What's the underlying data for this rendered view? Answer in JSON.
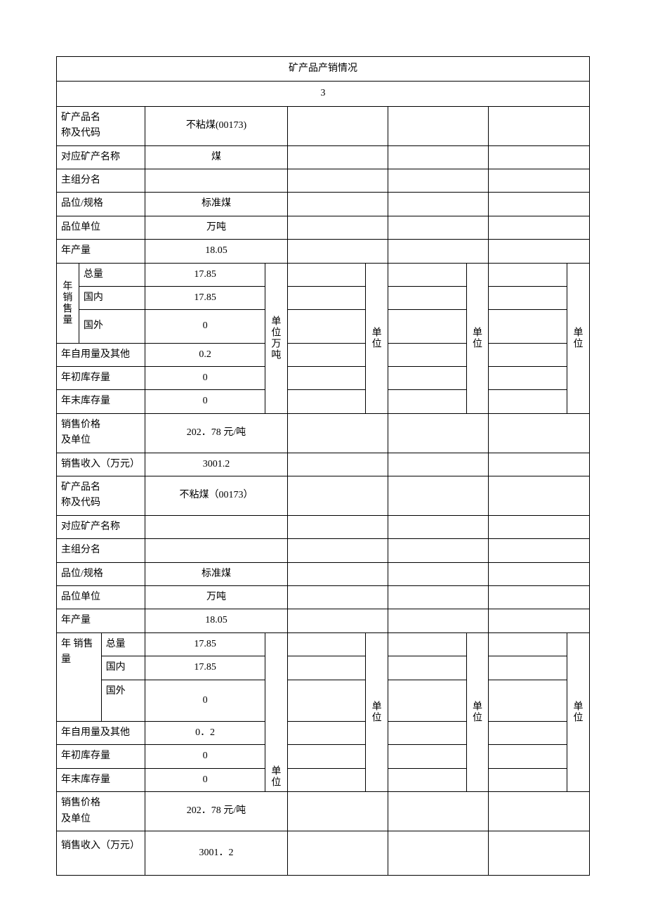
{
  "title": "矿产品产销情况",
  "page_number": "3",
  "labels": {
    "product_name_code": "矿产品名",
    "product_name_code2": "称及代码",
    "corresponding_mineral": "对应矿产名称",
    "main_group": "主组分名",
    "grade_spec": "品位/规格",
    "grade_unit": "品位单位",
    "annual_output": "年产量",
    "annual_sales": "年销售量",
    "annual_sales_v": "年 销售量",
    "total": "总量",
    "domestic": "国内",
    "overseas": "国外",
    "self_use": "年自用量及其他",
    "stock_begin": "年初库存量",
    "stock_end": "年末库存量",
    "price_unit": "销售价格",
    "price_unit2": "及单位",
    "sales_revenue": "销售收入（万元）",
    "unit_col": "单位",
    "unit_vert": "单位万吨",
    "unit_vert2": "单位"
  },
  "section1": {
    "product": "不粘煤(00173)",
    "mineral": "煤",
    "main_group": "",
    "grade_spec": "标准煤",
    "grade_unit": "万吨",
    "annual_output": "18.05",
    "sales_total": "17.85",
    "sales_domestic": "17.85",
    "sales_overseas": "0",
    "self_use": "0.2",
    "stock_begin": "0",
    "stock_end": "0",
    "price": "202．78 元/吨",
    "revenue": "3001.2"
  },
  "section2": {
    "product": "不粘煤（00173）",
    "mineral": "",
    "main_group": "",
    "grade_spec": "标准煤",
    "grade_unit": "万吨",
    "annual_output": "18.05",
    "sales_total": "17.85",
    "sales_domestic": "17.85",
    "sales_overseas": "0",
    "self_use": "0．2",
    "stock_begin": "0",
    "stock_end": "0",
    "price": "202．78 元/吨",
    "revenue": "3001．2"
  }
}
